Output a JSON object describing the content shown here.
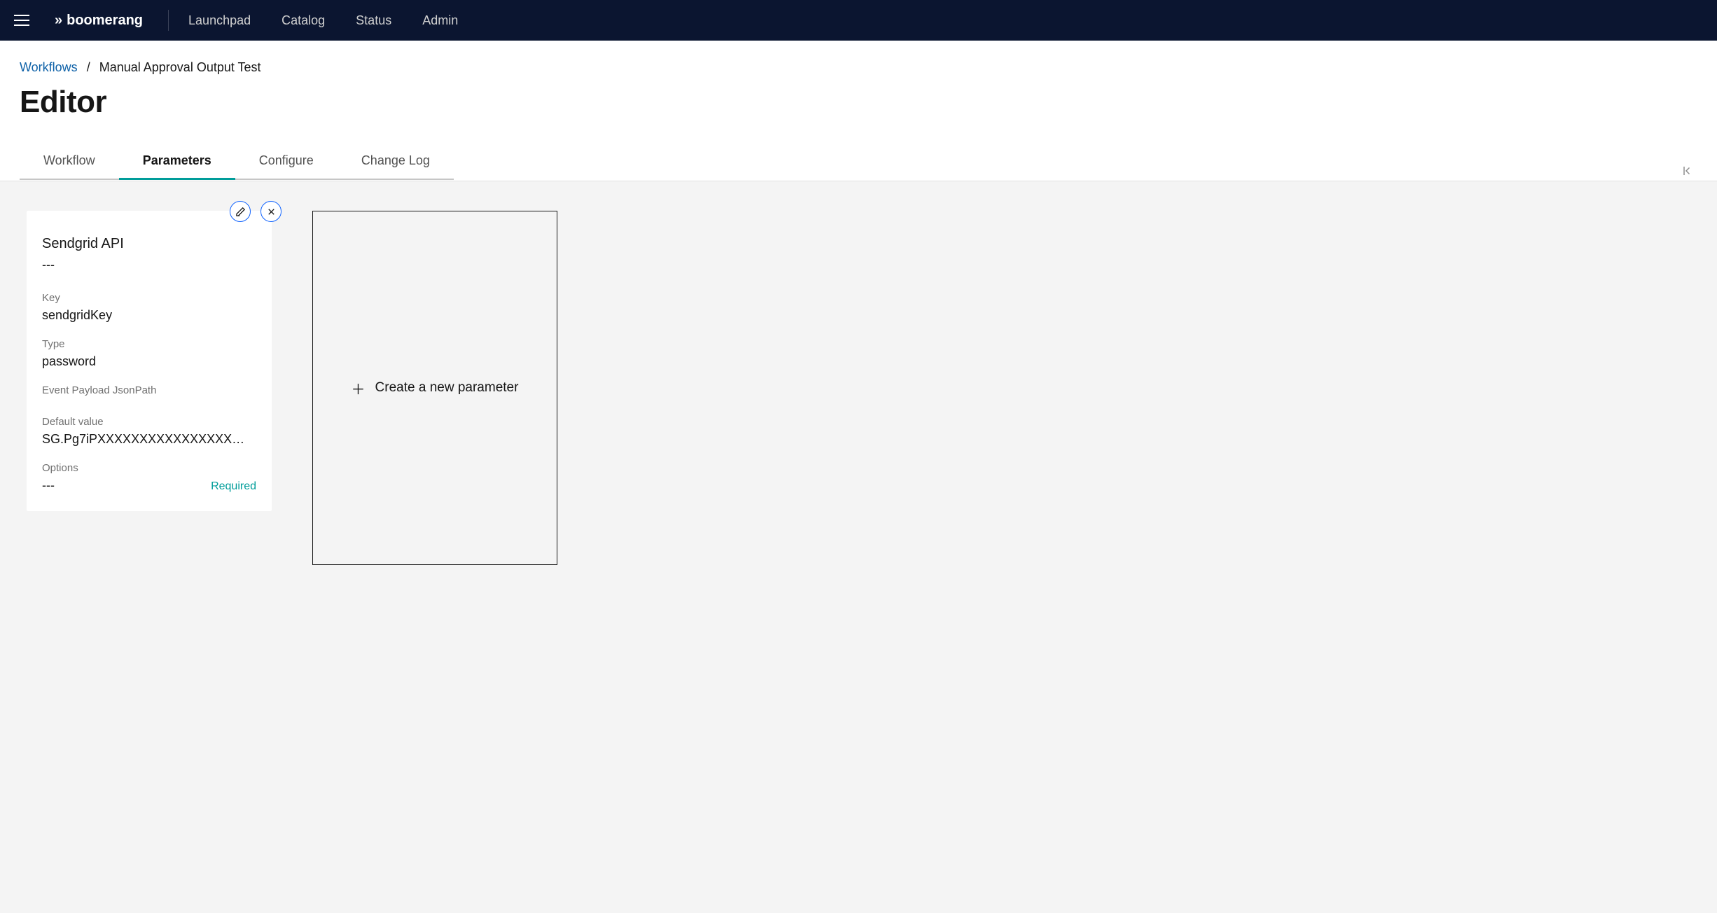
{
  "navbar": {
    "brand": "boomerang",
    "links": [
      "Launchpad",
      "Catalog",
      "Status",
      "Admin"
    ]
  },
  "breadcrumb": {
    "root": "Workflows",
    "current": "Manual Approval Output Test"
  },
  "page_title": "Editor",
  "tabs": [
    "Workflow",
    "Parameters",
    "Configure",
    "Change Log"
  ],
  "active_tab": "Parameters",
  "parameter_card": {
    "title": "Sendgrid API",
    "description": "---",
    "fields": {
      "key_label": "Key",
      "key_value": "sendgridKey",
      "type_label": "Type",
      "type_value": "password",
      "jsonpath_label": "Event Payload JsonPath",
      "jsonpath_value": "",
      "default_label": "Default value",
      "default_value": "SG.Pg7iPXXXXXXXXXXXXXXXX…",
      "options_label": "Options",
      "options_value": "---"
    },
    "required_label": "Required"
  },
  "create_card": {
    "label": "Create a new parameter"
  }
}
